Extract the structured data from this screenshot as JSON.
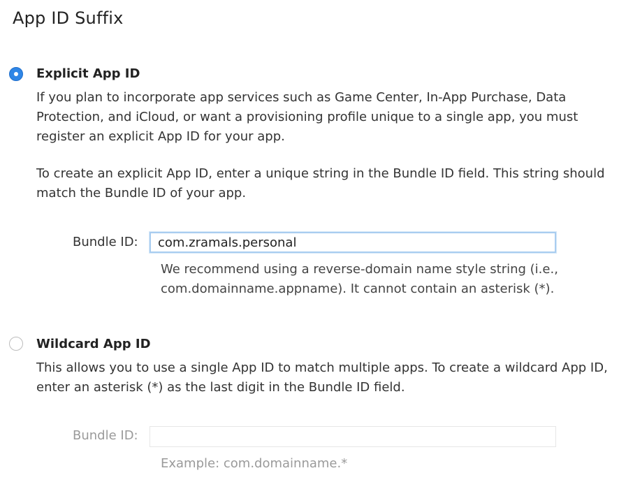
{
  "section": {
    "title": "App ID Suffix"
  },
  "explicit": {
    "label": "Explicit App ID",
    "selected": true,
    "description": "If you plan to incorporate app services such as Game Center, In-App Purchase, Data Protection, and iCloud, or want a provisioning profile unique to a single app, you must register an explicit App ID for your app.",
    "instructions": "To create an explicit App ID, enter a unique string in the Bundle ID field. This string should match the Bundle ID of your app.",
    "bundle_label": "Bundle ID:",
    "bundle_value": "com.zramals.personal",
    "hint": "We recommend using a reverse-domain name style string (i.e., com.domainname.appname). It cannot contain an asterisk (*)."
  },
  "wildcard": {
    "label": "Wildcard App ID",
    "selected": false,
    "description": "This allows you to use a single App ID to match multiple apps. To create a wildcard App ID, enter an asterisk (*) as the last digit in the Bundle ID field.",
    "bundle_label": "Bundle ID:",
    "bundle_value": "",
    "hint": "Example: com.domainname.*"
  },
  "colors": {
    "radio_selected": "#2f86e6",
    "focus_ring": "#a9cdf0",
    "disabled_text": "#9a9a9a"
  }
}
